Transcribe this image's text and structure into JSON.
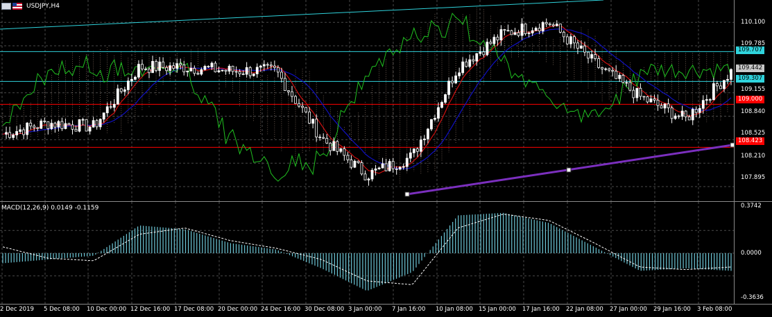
{
  "header": {
    "symbol_label": "USDJPY,H4"
  },
  "macd": {
    "label": "MACD(12,26,9) 0.0149 -0.1159",
    "scale_top": "0.3742",
    "scale_mid": "0.0000",
    "scale_bottom": "-0.3636"
  },
  "price_axis": [
    "110.100",
    "109.785",
    "109.155",
    "108.840",
    "108.525",
    "108.210",
    "107.895"
  ],
  "price_tags": {
    "line_top": "109.707",
    "current": "109.442",
    "line_mid": "109.307",
    "red_upper": "109.000",
    "red_lower": "108.423"
  },
  "time_axis": [
    "2 Dec 2019",
    "5 Dec 08:00",
    "10 Dec 00:00",
    "12 Dec 16:00",
    "17 Dec 08:00",
    "20 Dec 00:00",
    "24 Dec 16:00",
    "30 Dec 08:00",
    "3 Jan 00:00",
    "7 Jan 16:00",
    "10 Jan 08:00",
    "15 Jan 00:00",
    "17 Jan 16:00",
    "22 Jan 08:00",
    "27 Jan 00:00",
    "29 Jan 16:00",
    "3 Feb 08:00"
  ],
  "colors": {
    "background": "#000000",
    "grid": "#4a4a4a",
    "bull_candle": "#ffffff",
    "bear_candle": "#ffffff",
    "kijun": "#1010c0",
    "tenkan": "#d01010",
    "chikou": "#20c020",
    "cloud": "#d8b4a0",
    "trendline": "#7b2fbe",
    "hline_cyan": "#2fd3dc",
    "hline_red": "#ff0000",
    "macd_hist": "#6ec8d8"
  },
  "chart_data": [
    {
      "type": "candlestick",
      "title": "USDJPY,H4",
      "ylim": [
        107.7,
        110.4
      ],
      "x": [
        "2 Dec 2019",
        "5 Dec 08:00",
        "10 Dec 00:00",
        "12 Dec 16:00",
        "17 Dec 08:00",
        "20 Dec 00:00",
        "24 Dec 16:00",
        "30 Dec 08:00",
        "3 Jan 00:00",
        "7 Jan 16:00",
        "10 Jan 08:00",
        "15 Jan 00:00",
        "17 Jan 16:00",
        "22 Jan 08:00",
        "27 Jan 00:00",
        "29 Jan 16:00",
        "3 Feb 08:00"
      ],
      "close": [
        108.6,
        108.75,
        108.7,
        109.5,
        109.5,
        109.45,
        109.45,
        108.55,
        108.05,
        108.3,
        109.5,
        109.95,
        110.1,
        109.55,
        109.1,
        108.8,
        109.44
      ],
      "horizontal_lines": [
        109.707,
        109.307,
        109.0,
        108.423
      ],
      "grid": true
    },
    {
      "type": "histogram",
      "title": "MACD(12,26,9) 0.0149 -0.1159",
      "ylim": [
        -0.3636,
        0.3742
      ],
      "values": [
        -0.08,
        -0.05,
        -0.02,
        0.22,
        0.19,
        0.08,
        0.03,
        -0.12,
        -0.3,
        -0.15,
        0.3,
        0.32,
        0.24,
        0.05,
        -0.14,
        -0.12,
        -0.14
      ],
      "signal": [
        0.05,
        -0.04,
        -0.06,
        0.15,
        0.2,
        0.1,
        0.04,
        -0.05,
        -0.22,
        -0.25,
        0.2,
        0.31,
        0.26,
        0.08,
        -0.11,
        -0.13,
        -0.11
      ],
      "grid": true
    }
  ]
}
